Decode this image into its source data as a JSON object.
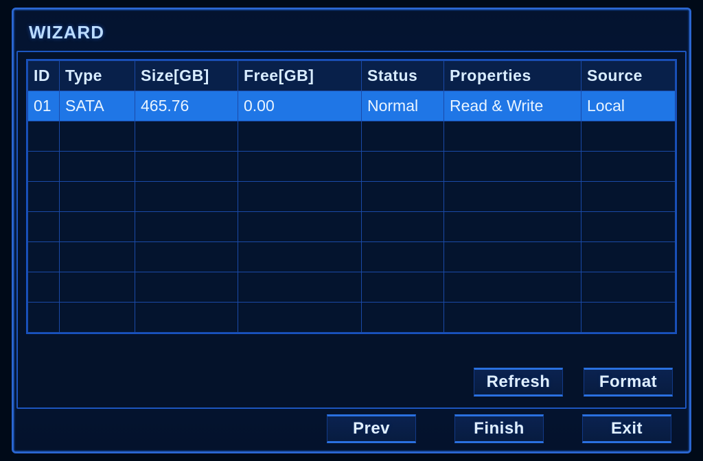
{
  "title": "WIZARD",
  "columns": {
    "id": "ID",
    "type": "Type",
    "size": "Size[GB]",
    "free": "Free[GB]",
    "status": "Status",
    "properties": "Properties",
    "source": "Source"
  },
  "rows": [
    {
      "id": "01",
      "type": "SATA",
      "size": "465.76",
      "free": "0.00",
      "status": "Normal",
      "properties": "Read & Write",
      "source": "Local",
      "selected": true
    }
  ],
  "empty_row_count": 7,
  "buttons": {
    "refresh": "Refresh",
    "format": "Format",
    "prev": "Prev",
    "finish": "Finish",
    "exit": "Exit"
  }
}
